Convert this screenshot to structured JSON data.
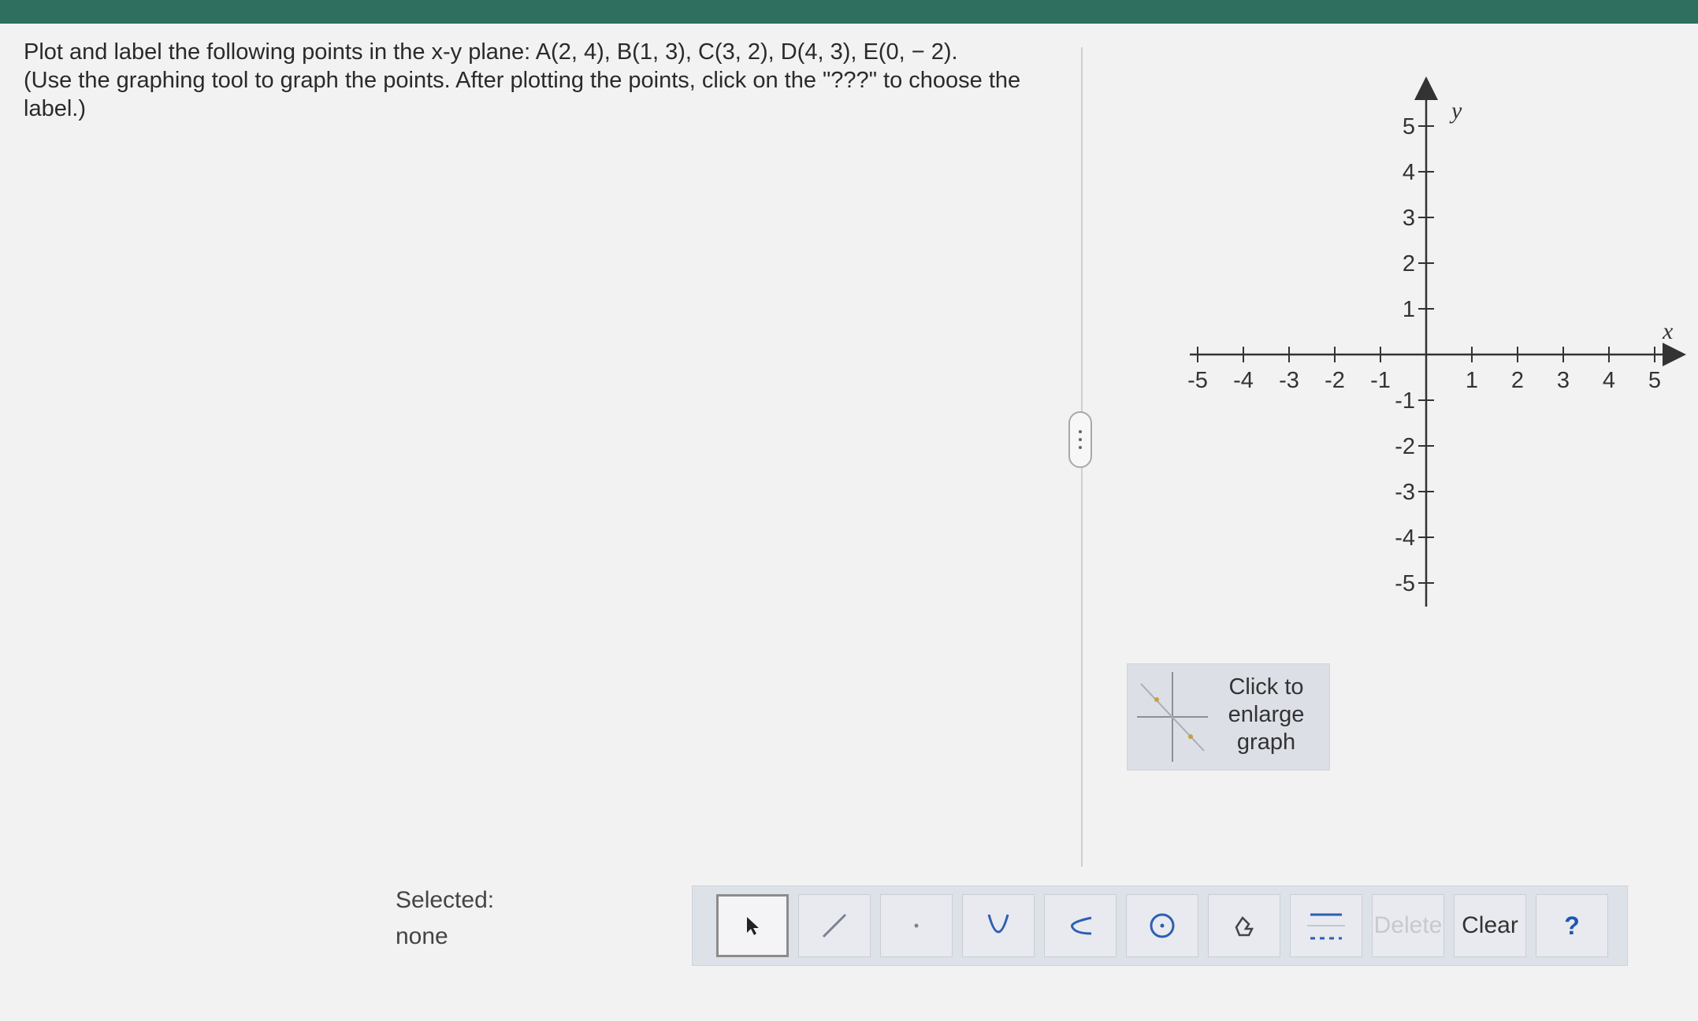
{
  "question": {
    "line1": "Plot and label the following points in the x-y plane: A(2, 4), B(1, 3), C(3, 2), D(4, 3), E(0, − 2).",
    "line2": "(Use the graphing tool to graph the points. After plotting the points, click on the \"???\" to choose the label.)"
  },
  "graph": {
    "x_axis_label": "x",
    "y_axis_label": "y",
    "x_ticks": [
      "-5",
      "-4",
      "-3",
      "-2",
      "-1",
      "1",
      "2",
      "3",
      "4",
      "5"
    ],
    "y_ticks_pos": [
      "5",
      "4",
      "3",
      "2",
      "1"
    ],
    "y_ticks_neg": [
      "-1",
      "-2",
      "-3",
      "-4",
      "-5"
    ],
    "xlim": [
      -5,
      5
    ],
    "ylim": [
      -5,
      5
    ]
  },
  "enlarge": {
    "label": "Click to enlarge graph"
  },
  "selection": {
    "label": "Selected:",
    "value": "none"
  },
  "toolbar": {
    "tools": [
      {
        "name": "pointer-icon",
        "active": true
      },
      {
        "name": "line-icon"
      },
      {
        "name": "point-icon"
      },
      {
        "name": "parabola-icon"
      },
      {
        "name": "arc-icon"
      },
      {
        "name": "circle-icon"
      },
      {
        "name": "shade-icon"
      },
      {
        "name": "solid-dashed-icon"
      }
    ],
    "delete_label": "Delete",
    "clear_label": "Clear",
    "help_label": "?"
  },
  "colors": {
    "header": "#2e6f60",
    "help": "#1f56b0"
  }
}
